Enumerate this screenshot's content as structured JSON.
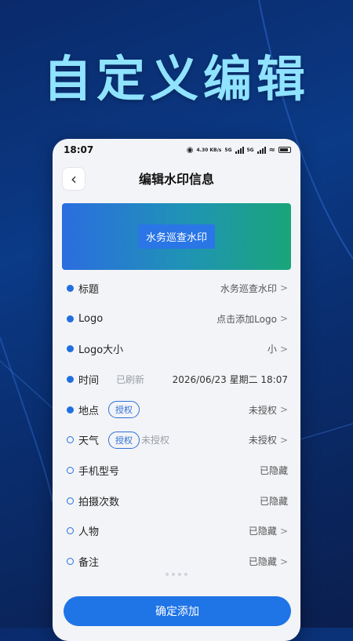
{
  "promo": {
    "title": "自定义编辑"
  },
  "status_bar": {
    "time": "18:07",
    "net_speed": "4.30 KB/s",
    "sig1": "5G",
    "sig2": "5G"
  },
  "header": {
    "title": "编辑水印信息"
  },
  "preview": {
    "label": "水务巡查水印"
  },
  "rows": [
    {
      "label": "标题",
      "value": "水务巡查水印",
      "chevron": ">",
      "filled": true
    },
    {
      "label": "Logo",
      "value": "点击添加Logo",
      "chevron": ">",
      "filled": true
    },
    {
      "label": "Logo大小",
      "value": "小",
      "chevron": ">",
      "filled": true
    },
    {
      "label": "时间",
      "extra": "已刷新",
      "value": "2026/06/23 星期二  18:07",
      "filled": true
    },
    {
      "label": "地点",
      "auth": "授权",
      "value": "未授权",
      "chevron": ">",
      "filled": true
    },
    {
      "label": "天气",
      "auth": "授权",
      "after_auth": "未授权",
      "value": "未授权",
      "chevron": ">",
      "filled": false
    },
    {
      "label": "手机型号",
      "value": "已隐藏",
      "filled": false
    },
    {
      "label": "拍摄次数",
      "value": "已隐藏",
      "filled": false
    },
    {
      "label": "人物",
      "value": "已隐藏",
      "chevron": ">",
      "filled": false
    },
    {
      "label": "备注",
      "value": "已隐藏",
      "chevron": ">",
      "filled": false
    }
  ],
  "confirm_button": {
    "label": "确定添加"
  },
  "colors": {
    "accent": "#1f74e6",
    "title_cyan": "#8fe3ff"
  }
}
